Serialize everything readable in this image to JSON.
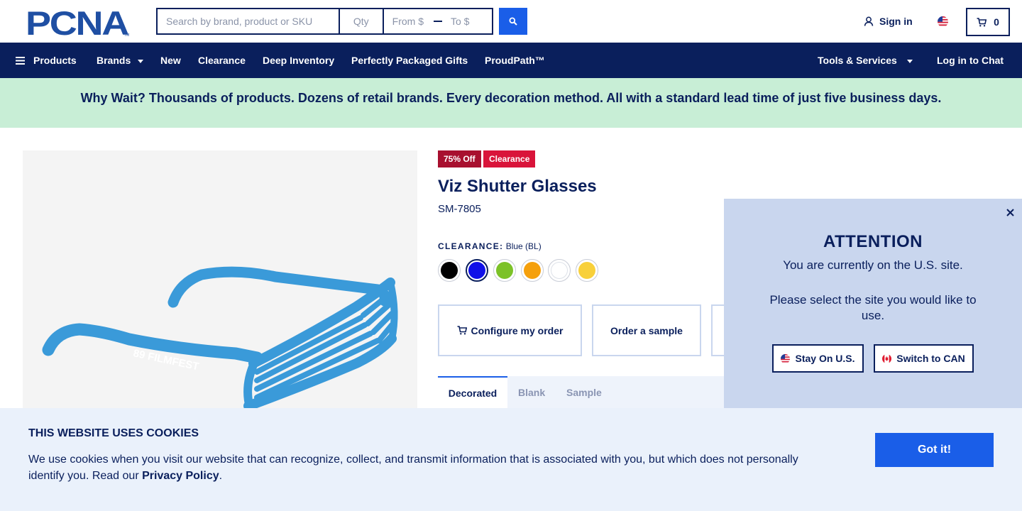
{
  "header": {
    "logo_text": "PCNA",
    "search_placeholder": "Search by brand, product or SKU",
    "qty_placeholder": "Qty",
    "from_placeholder": "From $",
    "to_placeholder": "To $",
    "sign_in": "Sign in",
    "cart_count": "0"
  },
  "nav": {
    "products": "Products",
    "brands": "Brands",
    "new": "New",
    "clearance": "Clearance",
    "deep_inventory": "Deep Inventory",
    "packaged_gifts": "Perfectly Packaged Gifts",
    "proudpath": "ProudPath™",
    "tools": "Tools & Services",
    "chat": "Log in to Chat"
  },
  "banner": {
    "text": "Why Wait? Thousands of products. Dozens of retail brands. Every decoration method. All with a standard lead time of just five business days."
  },
  "product": {
    "badge_discount": "75% Off",
    "badge_clearance": "Clearance",
    "title": "Viz Shutter Glasses",
    "sku": "SM-7805",
    "color_label": "CLEARANCE:",
    "color_value": "Blue (BL)",
    "imprint_text": "89 FILMFEST",
    "swatches": [
      {
        "name": "Black",
        "color": "#000000",
        "selected": false
      },
      {
        "name": "Blue",
        "color": "#1010e8",
        "selected": true
      },
      {
        "name": "Green",
        "color": "#7cc228",
        "selected": false
      },
      {
        "name": "Orange",
        "color": "#f5a00c",
        "selected": false
      },
      {
        "name": "White",
        "color": "#ffffff",
        "selected": false
      },
      {
        "name": "Yellow",
        "color": "#f8d03a",
        "selected": false
      }
    ],
    "configure_label": "Configure my order",
    "sample_label": "Order a sample"
  },
  "tabs": {
    "decorated": "Decorated",
    "blank": "Blank",
    "sample": "Sample"
  },
  "modal": {
    "title": "ATTENTION",
    "line1": "You are currently on the U.S. site.",
    "line2": "Please select the site you would like to use.",
    "stay_label": "Stay On U.S.",
    "switch_label": "Switch to CAN"
  },
  "cookies": {
    "title": "THIS WEBSITE USES COOKIES",
    "text": "We use cookies when you visit our website that can recognize, collect, and transmit information that is associated with you, but which does not personally identify you. Read our ",
    "link": "Privacy Policy",
    "period": ".",
    "button": "Got it!"
  },
  "colors": {
    "navy": "#0a1f5c",
    "accent_blue": "#1a5ee8",
    "banner_green": "#c8eed6",
    "modal_bg": "#c9d6ee",
    "clearance_red": "#d9143a"
  }
}
